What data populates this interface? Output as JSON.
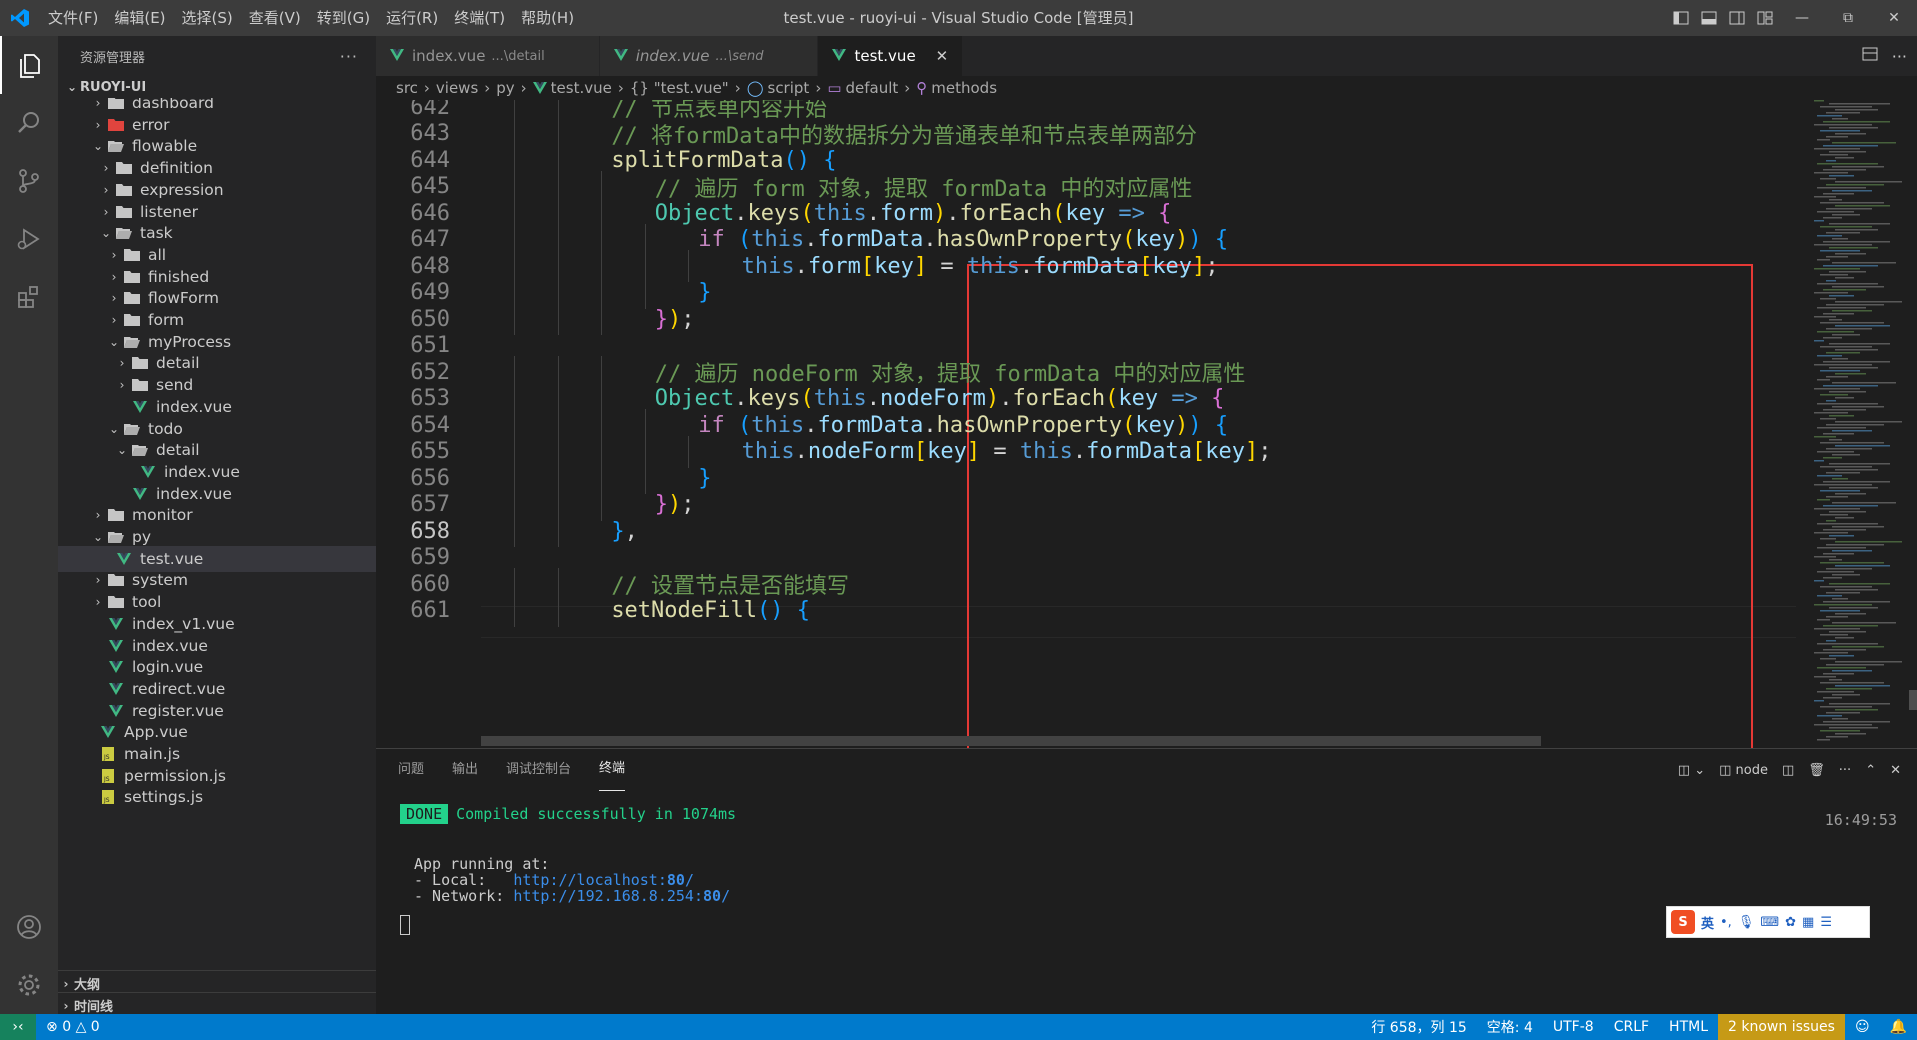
{
  "titlebar": {
    "menu": [
      "文件(F)",
      "编辑(E)",
      "选择(S)",
      "查看(V)",
      "转到(G)",
      "运行(R)",
      "终端(T)",
      "帮助(H)"
    ],
    "title": "test.vue - ruoyi-ui - Visual Studio Code [管理员]"
  },
  "sidebar": {
    "header": "资源管理器",
    "project": "RUOYI-UI",
    "tree": [
      {
        "label": "dashboard",
        "type": "folder",
        "depth": 1,
        "open": false,
        "partial": true
      },
      {
        "label": "error",
        "type": "folder-red",
        "depth": 1,
        "open": false
      },
      {
        "label": "flowable",
        "type": "folder",
        "depth": 1,
        "open": true
      },
      {
        "label": "definition",
        "type": "folder",
        "depth": 2,
        "open": false
      },
      {
        "label": "expression",
        "type": "folder",
        "depth": 2,
        "open": false
      },
      {
        "label": "listener",
        "type": "folder",
        "depth": 2,
        "open": false
      },
      {
        "label": "task",
        "type": "folder",
        "depth": 2,
        "open": true
      },
      {
        "label": "all",
        "type": "folder",
        "depth": 3,
        "open": false
      },
      {
        "label": "finished",
        "type": "folder",
        "depth": 3,
        "open": false
      },
      {
        "label": "flowForm",
        "type": "folder",
        "depth": 3,
        "open": false
      },
      {
        "label": "form",
        "type": "folder",
        "depth": 3,
        "open": false
      },
      {
        "label": "myProcess",
        "type": "folder",
        "depth": 3,
        "open": true
      },
      {
        "label": "detail",
        "type": "folder",
        "depth": 4,
        "open": false
      },
      {
        "label": "send",
        "type": "folder",
        "depth": 4,
        "open": false
      },
      {
        "label": "index.vue",
        "type": "vue",
        "depth": 4
      },
      {
        "label": "todo",
        "type": "folder",
        "depth": 3,
        "open": true
      },
      {
        "label": "detail",
        "type": "folder",
        "depth": 4,
        "open": true
      },
      {
        "label": "index.vue",
        "type": "vue",
        "depth": 5
      },
      {
        "label": "index.vue",
        "type": "vue",
        "depth": 4
      },
      {
        "label": "monitor",
        "type": "folder",
        "depth": 1,
        "open": false
      },
      {
        "label": "py",
        "type": "folder",
        "depth": 1,
        "open": true
      },
      {
        "label": "test.vue",
        "type": "vue",
        "depth": 2,
        "selected": true
      },
      {
        "label": "system",
        "type": "folder",
        "depth": 1,
        "open": false
      },
      {
        "label": "tool",
        "type": "folder",
        "depth": 1,
        "open": false
      },
      {
        "label": "index_v1.vue",
        "type": "vue",
        "depth": 1
      },
      {
        "label": "index.vue",
        "type": "vue",
        "depth": 1
      },
      {
        "label": "login.vue",
        "type": "vue",
        "depth": 1
      },
      {
        "label": "redirect.vue",
        "type": "vue",
        "depth": 1
      },
      {
        "label": "register.vue",
        "type": "vue",
        "depth": 1
      },
      {
        "label": "App.vue",
        "type": "vue",
        "depth": 0
      },
      {
        "label": "main.js",
        "type": "js",
        "depth": 0
      },
      {
        "label": "permission.js",
        "type": "js",
        "depth": 0
      },
      {
        "label": "settings.js",
        "type": "js",
        "depth": 0
      }
    ],
    "outline": "大纲",
    "timeline": "时间线"
  },
  "tabs": [
    {
      "label": "index.vue",
      "desc": "...\\detail",
      "italic": false,
      "active": false
    },
    {
      "label": "index.vue",
      "desc": "...\\send",
      "italic": true,
      "active": false
    },
    {
      "label": "test.vue",
      "desc": "",
      "italic": false,
      "active": true
    }
  ],
  "breadcrumb": [
    "src",
    "views",
    "py",
    "test.vue",
    "{} \"test.vue\"",
    "script",
    "default",
    "methods"
  ],
  "editor": {
    "current_line": 658,
    "lines": [
      {
        "n": 642,
        "indent": 3,
        "t": [
          [
            "c-cm",
            "// 节点表单内容开始"
          ]
        ]
      },
      {
        "n": 643,
        "indent": 3,
        "t": [
          [
            "c-cm",
            "// 将formData中的数据拆分为普通表单和节点表单两部分"
          ]
        ]
      },
      {
        "n": 644,
        "indent": 3,
        "t": [
          [
            "c-fn",
            "splitFormData"
          ],
          [
            "c-b3",
            "()"
          ],
          [
            "c-p",
            " "
          ],
          [
            "c-b3",
            "{"
          ]
        ]
      },
      {
        "n": 645,
        "indent": 4,
        "t": [
          [
            "c-cm",
            "// 遍历 form 对象，提取 formData 中的对应属性"
          ]
        ]
      },
      {
        "n": 646,
        "indent": 4,
        "t": [
          [
            "c-cls",
            "Object"
          ],
          [
            "c-p",
            "."
          ],
          [
            "c-fn",
            "keys"
          ],
          [
            "c-b1",
            "("
          ],
          [
            "c-kw",
            "this"
          ],
          [
            "c-p",
            "."
          ],
          [
            "c-var",
            "form"
          ],
          [
            "c-b1",
            ")"
          ],
          [
            "c-p",
            "."
          ],
          [
            "c-fn",
            "forEach"
          ],
          [
            "c-b1",
            "("
          ],
          [
            "c-var",
            "key"
          ],
          [
            "c-p",
            " "
          ],
          [
            "c-kw",
            "=>"
          ],
          [
            "c-p",
            " "
          ],
          [
            "c-b2",
            "{"
          ]
        ]
      },
      {
        "n": 647,
        "indent": 5,
        "t": [
          [
            "c-ctl",
            "if"
          ],
          [
            "c-p",
            " "
          ],
          [
            "c-b3",
            "("
          ],
          [
            "c-kw",
            "this"
          ],
          [
            "c-p",
            "."
          ],
          [
            "c-var",
            "formData"
          ],
          [
            "c-p",
            "."
          ],
          [
            "c-fn",
            "hasOwnProperty"
          ],
          [
            "c-b1",
            "("
          ],
          [
            "c-var",
            "key"
          ],
          [
            "c-b1",
            ")"
          ],
          [
            "c-b3",
            ")"
          ],
          [
            "c-p",
            " "
          ],
          [
            "c-b3",
            "{"
          ]
        ]
      },
      {
        "n": 648,
        "indent": 6,
        "t": [
          [
            "c-kw",
            "this"
          ],
          [
            "c-p",
            "."
          ],
          [
            "c-var",
            "form"
          ],
          [
            "c-b1",
            "["
          ],
          [
            "c-var",
            "key"
          ],
          [
            "c-b1",
            "]"
          ],
          [
            "c-p",
            " = "
          ],
          [
            "c-kw",
            "this"
          ],
          [
            "c-p",
            "."
          ],
          [
            "c-var",
            "formData"
          ],
          [
            "c-b1",
            "["
          ],
          [
            "c-var",
            "key"
          ],
          [
            "c-b1",
            "]"
          ],
          [
            "c-p",
            ";"
          ]
        ]
      },
      {
        "n": 649,
        "indent": 5,
        "t": [
          [
            "c-b3",
            "}"
          ]
        ]
      },
      {
        "n": 650,
        "indent": 4,
        "t": [
          [
            "c-b2",
            "}"
          ],
          [
            "c-b1",
            ")"
          ],
          [
            "c-p",
            ";"
          ]
        ]
      },
      {
        "n": 651,
        "indent": 0,
        "t": []
      },
      {
        "n": 652,
        "indent": 4,
        "t": [
          [
            "c-cm",
            "// 遍历 nodeForm 对象，提取 formData 中的对应属性"
          ]
        ]
      },
      {
        "n": 653,
        "indent": 4,
        "t": [
          [
            "c-cls",
            "Object"
          ],
          [
            "c-p",
            "."
          ],
          [
            "c-fn",
            "keys"
          ],
          [
            "c-b1",
            "("
          ],
          [
            "c-kw",
            "this"
          ],
          [
            "c-p",
            "."
          ],
          [
            "c-var",
            "nodeForm"
          ],
          [
            "c-b1",
            ")"
          ],
          [
            "c-p",
            "."
          ],
          [
            "c-fn",
            "forEach"
          ],
          [
            "c-b1",
            "("
          ],
          [
            "c-var",
            "key"
          ],
          [
            "c-p",
            " "
          ],
          [
            "c-kw",
            "=>"
          ],
          [
            "c-p",
            " "
          ],
          [
            "c-b2",
            "{"
          ]
        ]
      },
      {
        "n": 654,
        "indent": 5,
        "t": [
          [
            "c-ctl",
            "if"
          ],
          [
            "c-p",
            " "
          ],
          [
            "c-b3",
            "("
          ],
          [
            "c-kw",
            "this"
          ],
          [
            "c-p",
            "."
          ],
          [
            "c-var",
            "formData"
          ],
          [
            "c-p",
            "."
          ],
          [
            "c-fn",
            "hasOwnProperty"
          ],
          [
            "c-b1",
            "("
          ],
          [
            "c-var",
            "key"
          ],
          [
            "c-b1",
            ")"
          ],
          [
            "c-b3",
            ")"
          ],
          [
            "c-p",
            " "
          ],
          [
            "c-b3",
            "{"
          ]
        ]
      },
      {
        "n": 655,
        "indent": 6,
        "t": [
          [
            "c-kw",
            "this"
          ],
          [
            "c-p",
            "."
          ],
          [
            "c-var",
            "nodeForm"
          ],
          [
            "c-b1",
            "["
          ],
          [
            "c-var",
            "key"
          ],
          [
            "c-b1",
            "]"
          ],
          [
            "c-p",
            " = "
          ],
          [
            "c-kw",
            "this"
          ],
          [
            "c-p",
            "."
          ],
          [
            "c-var",
            "formData"
          ],
          [
            "c-b1",
            "["
          ],
          [
            "c-var",
            "key"
          ],
          [
            "c-b1",
            "]"
          ],
          [
            "c-p",
            ";"
          ]
        ]
      },
      {
        "n": 656,
        "indent": 5,
        "t": [
          [
            "c-b3",
            "}"
          ]
        ]
      },
      {
        "n": 657,
        "indent": 4,
        "t": [
          [
            "c-b2",
            "}"
          ],
          [
            "c-b1",
            ")"
          ],
          [
            "c-p",
            ";"
          ]
        ]
      },
      {
        "n": 658,
        "indent": 3,
        "t": [
          [
            "c-b3",
            "}"
          ],
          [
            "c-p",
            ","
          ]
        ]
      },
      {
        "n": 659,
        "indent": 0,
        "t": []
      },
      {
        "n": 660,
        "indent": 3,
        "t": [
          [
            "c-cm",
            "// 设置节点是否能填写"
          ]
        ]
      },
      {
        "n": 661,
        "indent": 3,
        "t": [
          [
            "c-fn",
            "setNodeFill"
          ],
          [
            "c-b3",
            "()"
          ],
          [
            "c-p",
            " "
          ],
          [
            "c-b3",
            "{"
          ]
        ]
      }
    ]
  },
  "panel": {
    "tabs": [
      "问题",
      "输出",
      "调试控制台",
      "终端"
    ],
    "active_tab": "终端",
    "terminal_name": "node",
    "done_badge": "DONE",
    "compiled_msg": "Compiled successfully in 1074ms",
    "time": "16:49:53",
    "app_running": "App running at:",
    "local_label": "- Local:   ",
    "local_url_prefix": "http://localhost:",
    "local_port": "80",
    "local_url_suffix": "/",
    "network_label": "- Network: ",
    "network_url_prefix": "http://192.168.8.254:",
    "network_port": "80",
    "network_url_suffix": "/",
    "ime_label": "英"
  },
  "statusbar": {
    "errors": "0",
    "warnings": "0",
    "position": "行 658，列 15",
    "spaces": "空格: 4",
    "encoding": "UTF-8",
    "eol": "CRLF",
    "language": "HTML",
    "issues": "2 known issues"
  },
  "colors": {
    "accent": "#007acc",
    "vue_green": "#41b883",
    "highlight_box": "#e53935",
    "done_green": "#23d18b"
  }
}
